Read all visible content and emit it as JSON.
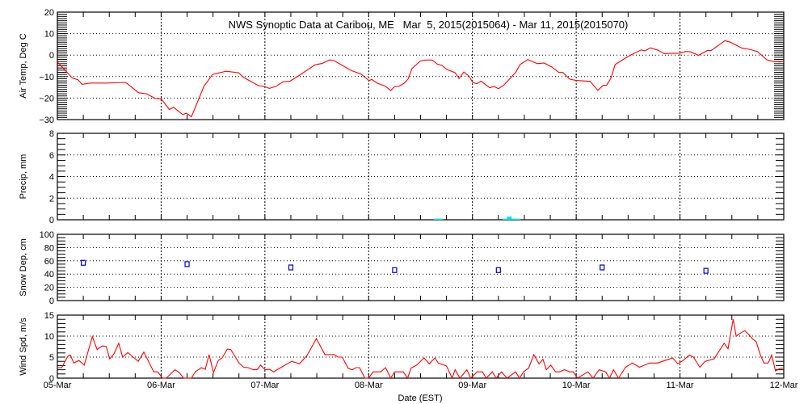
{
  "chart_data": [
    {
      "type": "line",
      "title": "NWS Synoptic Data at Caribou, ME   Mar  5, 2015(2015064) - Mar 11, 2015(2015070)",
      "ylabel": "Air Temp, Deg C",
      "ylim": [
        -30,
        20
      ],
      "yticks": [
        -30,
        -20,
        -10,
        0,
        10,
        20
      ],
      "x_unit": "hours since 05-Mar 00:00 EST",
      "color": "#ff0000",
      "points": [
        [
          0,
          -3.2
        ],
        [
          3.5,
          -10.7
        ],
        [
          4.8,
          -11.5
        ],
        [
          5.7,
          -13.6
        ],
        [
          7.6,
          -13
        ],
        [
          11.3,
          -13
        ],
        [
          15.4,
          -12.7
        ],
        [
          16,
          -13
        ],
        [
          18.8,
          -17.5
        ],
        [
          20.7,
          -18
        ],
        [
          22.6,
          -20.2
        ],
        [
          24,
          -20.3
        ],
        [
          25.9,
          -25.3
        ],
        [
          26.9,
          -24.3
        ],
        [
          29,
          -27.7
        ],
        [
          29.8,
          -27
        ],
        [
          31,
          -28.7
        ],
        [
          33.9,
          -14.5
        ],
        [
          35.9,
          -9
        ],
        [
          39,
          -7.5
        ],
        [
          41.9,
          -8.2
        ],
        [
          43.1,
          -10.4
        ],
        [
          46.5,
          -14.2
        ],
        [
          47.8,
          -14.5
        ],
        [
          49,
          -15.5
        ],
        [
          50.6,
          -14.5
        ],
        [
          52.2,
          -12.4
        ],
        [
          53.7,
          -12.2
        ],
        [
          55.9,
          -9.5
        ],
        [
          59.6,
          -4.5
        ],
        [
          61.2,
          -3.9
        ],
        [
          63,
          -2.2
        ],
        [
          64,
          -2.6
        ],
        [
          68,
          -7.2
        ],
        [
          70.2,
          -8.8
        ],
        [
          72.1,
          -11.9
        ],
        [
          72.7,
          -11.3
        ],
        [
          74,
          -13.1
        ],
        [
          75.8,
          -14.4
        ],
        [
          77.1,
          -16.5
        ],
        [
          78,
          -14.6
        ],
        [
          78.9,
          -14.6
        ],
        [
          80.2,
          -13.1
        ],
        [
          81.1,
          -11.2
        ],
        [
          82,
          -6.3
        ],
        [
          83.9,
          -2.8
        ],
        [
          85.1,
          -2.3
        ],
        [
          86.7,
          -2.3
        ],
        [
          87.9,
          -4.2
        ],
        [
          88.9,
          -4.7
        ],
        [
          90.1,
          -6.7
        ],
        [
          92,
          -8.2
        ],
        [
          92.9,
          -10.9
        ],
        [
          94,
          -7.9
        ],
        [
          95.1,
          -9.6
        ],
        [
          96.1,
          -12.7
        ],
        [
          97,
          -13.3
        ],
        [
          98,
          -12.1
        ],
        [
          100,
          -15.2
        ],
        [
          101,
          -14.6
        ],
        [
          102,
          -15.6
        ],
        [
          103.2,
          -14.1
        ],
        [
          106,
          -8.1
        ],
        [
          107,
          -4.4
        ],
        [
          108.8,
          -2.1
        ],
        [
          111,
          -4
        ],
        [
          112.6,
          -3.7
        ],
        [
          114.4,
          -5.6
        ],
        [
          116,
          -8.1
        ],
        [
          116.9,
          -8.1
        ],
        [
          118.5,
          -11.2
        ],
        [
          120,
          -11.8
        ],
        [
          123.2,
          -12.2
        ],
        [
          125,
          -16.4
        ],
        [
          126.2,
          -14.1
        ],
        [
          127,
          -14.1
        ],
        [
          128,
          -10.8
        ],
        [
          129,
          -4.4
        ],
        [
          131.9,
          -0.7
        ],
        [
          133.1,
          0.5
        ],
        [
          135,
          2.4
        ],
        [
          135.9,
          2
        ],
        [
          137.2,
          3.4
        ],
        [
          139,
          2.2
        ],
        [
          140.3,
          0.7
        ],
        [
          144,
          0.9
        ],
        [
          145.3,
          1.7
        ],
        [
          146.5,
          1.5
        ],
        [
          148.3,
          -0.1
        ],
        [
          150.3,
          2.1
        ],
        [
          151.2,
          2.1
        ],
        [
          154.4,
          6.7
        ],
        [
          155.6,
          6
        ],
        [
          158.4,
          3.2
        ],
        [
          160,
          2.7
        ],
        [
          161.9,
          1.7
        ],
        [
          164.1,
          -2.2
        ],
        [
          165.7,
          -3
        ],
        [
          167.2,
          -3.2
        ],
        [
          168,
          -2.8
        ]
      ]
    },
    {
      "type": "bar",
      "ylabel": "Precip, mm",
      "ylim": [
        0,
        8
      ],
      "yticks": [
        0,
        2,
        4,
        6,
        8
      ],
      "x_unit": "hours since 05-Mar 00:00 EST",
      "color": "#00e5e5",
      "bars": [
        [
          87,
          0.1
        ],
        [
          88,
          0.1
        ],
        [
          103,
          0.1
        ],
        [
          104,
          0.3
        ],
        [
          105,
          0.1
        ],
        [
          106,
          0.1
        ]
      ]
    },
    {
      "type": "scatter",
      "ylabel": "Snow Dep, cm",
      "ylim": [
        0,
        100
      ],
      "yticks": [
        0,
        20,
        40,
        60,
        80,
        100
      ],
      "x_unit": "hours since 05-Mar 00:00 EST",
      "color": "#0000cc",
      "points": [
        [
          6,
          57
        ],
        [
          30,
          55
        ],
        [
          54,
          50
        ],
        [
          78,
          46
        ],
        [
          102,
          46
        ],
        [
          126,
          50
        ],
        [
          150,
          45
        ]
      ]
    },
    {
      "type": "line",
      "ylabel": "Wind Spd, m/s",
      "ylim": [
        0,
        15
      ],
      "yticks": [
        0,
        5,
        10,
        15
      ],
      "x_unit": "hours since 05-Mar 00:00 EST",
      "color": "#ff0000",
      "xlabel": "Date (EST)",
      "xticks": [
        "05-Mar",
        "06-Mar",
        "07-Mar",
        "08-Mar",
        "09-Mar",
        "10-Mar",
        "11-Mar",
        "12-Mar"
      ],
      "points": [
        [
          0,
          2.5
        ],
        [
          1,
          2.5
        ],
        [
          2.4,
          5.2
        ],
        [
          3,
          5.5
        ],
        [
          3.8,
          3.6
        ],
        [
          5,
          4.2
        ],
        [
          6.2,
          3.1
        ],
        [
          8.1,
          9.9
        ],
        [
          9.2,
          6.8
        ],
        [
          10.4,
          7.7
        ],
        [
          11.3,
          7.5
        ],
        [
          12.1,
          4.6
        ],
        [
          13.1,
          5.8
        ],
        [
          14.2,
          8.3
        ],
        [
          15.1,
          5
        ],
        [
          16.3,
          6.1
        ],
        [
          17.3,
          5.2
        ],
        [
          18.7,
          4
        ],
        [
          20,
          6.2
        ],
        [
          22.3,
          1.5
        ],
        [
          23.2,
          1.5
        ],
        [
          24.3,
          0
        ],
        [
          25.2,
          0
        ],
        [
          27.2,
          2
        ],
        [
          28.2,
          1.3
        ],
        [
          29.2,
          0
        ],
        [
          31,
          0
        ],
        [
          31.9,
          1.5
        ],
        [
          33.3,
          2.5
        ],
        [
          34.2,
          2.1
        ],
        [
          35.1,
          5.6
        ],
        [
          36.1,
          1.3
        ],
        [
          37.2,
          4.2
        ],
        [
          38.1,
          4.8
        ],
        [
          39.3,
          6.9
        ],
        [
          40.1,
          6.8
        ],
        [
          42,
          3.6
        ],
        [
          43.1,
          2.6
        ],
        [
          44.1,
          2.5
        ],
        [
          45.3,
          2
        ],
        [
          46.2,
          2
        ],
        [
          47,
          3.1
        ],
        [
          48,
          2
        ],
        [
          49.1,
          2.1
        ],
        [
          50,
          1.5
        ],
        [
          51.8,
          2.6
        ],
        [
          54.2,
          4
        ],
        [
          56,
          3.4
        ],
        [
          57.8,
          5.5
        ],
        [
          59.9,
          9.4
        ],
        [
          61.9,
          5.6
        ],
        [
          64.1,
          5.6
        ],
        [
          64.9,
          5
        ],
        [
          65.9,
          5
        ],
        [
          67.3,
          2.3
        ],
        [
          68.2,
          2
        ],
        [
          69.1,
          2.5
        ],
        [
          69.9,
          2.5
        ],
        [
          71.1,
          0
        ],
        [
          72,
          0
        ],
        [
          73,
          1.5
        ],
        [
          74.8,
          1.5
        ],
        [
          75.9,
          2.5
        ],
        [
          77.1,
          0
        ],
        [
          78,
          1.5
        ],
        [
          80,
          1.5
        ],
        [
          81,
          0
        ],
        [
          81.8,
          2.4
        ],
        [
          83.1,
          3.1
        ],
        [
          84.8,
          4.8
        ],
        [
          86,
          3.4
        ],
        [
          87.3,
          4.8
        ],
        [
          88.1,
          3.6
        ],
        [
          90,
          2.9
        ],
        [
          91.3,
          0
        ],
        [
          92,
          2
        ],
        [
          93.1,
          0
        ],
        [
          94.7,
          2
        ],
        [
          95.6,
          0
        ],
        [
          97.1,
          1.5
        ],
        [
          98.3,
          1.5
        ],
        [
          99.2,
          0
        ],
        [
          100.6,
          1.5
        ],
        [
          101.5,
          0
        ],
        [
          102.7,
          1.5
        ],
        [
          104,
          0
        ],
        [
          106,
          1.5
        ],
        [
          106.9,
          0
        ],
        [
          107.8,
          1.5
        ],
        [
          109,
          2.4
        ],
        [
          110.2,
          5.6
        ],
        [
          111.4,
          3.4
        ],
        [
          112.3,
          4.5
        ],
        [
          113.1,
          2
        ],
        [
          114.1,
          3.1
        ],
        [
          115.2,
          1.5
        ],
        [
          116.1,
          1.5
        ],
        [
          117.3,
          2
        ],
        [
          118.5,
          1.5
        ],
        [
          119.3,
          1.5
        ],
        [
          120.3,
          0
        ],
        [
          122.7,
          1.5
        ],
        [
          123.9,
          0
        ],
        [
          125.3,
          2
        ],
        [
          126.8,
          1.5
        ],
        [
          127.7,
          0
        ],
        [
          128.6,
          2
        ],
        [
          129.8,
          0
        ],
        [
          131.4,
          2.6
        ],
        [
          133,
          3.6
        ],
        [
          134.6,
          2.6
        ],
        [
          137,
          3.6
        ],
        [
          138.8,
          3.6
        ],
        [
          140.5,
          4.2
        ],
        [
          142.3,
          4.8
        ],
        [
          143.5,
          3.4
        ],
        [
          144.7,
          4.2
        ],
        [
          146.2,
          5.5
        ],
        [
          147.1,
          5
        ],
        [
          148.6,
          2.6
        ],
        [
          149.8,
          4
        ],
        [
          151.9,
          4.6
        ],
        [
          154.2,
          8.3
        ],
        [
          155.1,
          7
        ],
        [
          156.3,
          14
        ],
        [
          157,
          10
        ],
        [
          157.8,
          10.6
        ],
        [
          159,
          11.3
        ],
        [
          159.8,
          10.5
        ],
        [
          160.8,
          9.3
        ],
        [
          161.6,
          8.7
        ],
        [
          162.6,
          5.5
        ],
        [
          163.4,
          3.6
        ],
        [
          164.4,
          3.6
        ],
        [
          165.2,
          5.5
        ],
        [
          166.1,
          1.7
        ],
        [
          167.1,
          2.3
        ],
        [
          168,
          2.4
        ]
      ]
    }
  ]
}
